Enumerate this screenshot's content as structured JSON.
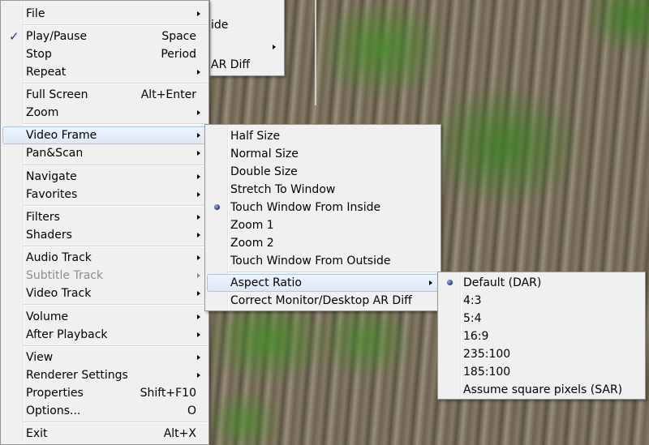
{
  "background_menu": {
    "items": [
      {
        "label": "ide"
      },
      {
        "label": "AR Diff"
      }
    ]
  },
  "main_menu": {
    "items": [
      {
        "label": "File",
        "shortcut": "",
        "submenu": true
      },
      {
        "label": "Play/Pause",
        "shortcut": "Space",
        "checked": true
      },
      {
        "label": "Stop",
        "shortcut": "Period"
      },
      {
        "label": "Repeat",
        "shortcut": "",
        "submenu": true
      },
      {
        "label": "Full Screen",
        "shortcut": "Alt+Enter"
      },
      {
        "label": "Zoom",
        "shortcut": "",
        "submenu": true
      },
      {
        "label": "Video Frame",
        "shortcut": "",
        "submenu": true,
        "highlighted": true
      },
      {
        "label": "Pan&Scan",
        "shortcut": "",
        "submenu": true
      },
      {
        "label": "Navigate",
        "shortcut": "",
        "submenu": true
      },
      {
        "label": "Favorites",
        "shortcut": "",
        "submenu": true
      },
      {
        "label": "Filters",
        "shortcut": "",
        "submenu": true
      },
      {
        "label": "Shaders",
        "shortcut": "",
        "submenu": true
      },
      {
        "label": "Audio Track",
        "shortcut": "",
        "submenu": true
      },
      {
        "label": "Subtitle Track",
        "shortcut": "",
        "submenu": true,
        "disabled": true
      },
      {
        "label": "Video Track",
        "shortcut": "",
        "submenu": true
      },
      {
        "label": "Volume",
        "shortcut": "",
        "submenu": true
      },
      {
        "label": "After Playback",
        "shortcut": "",
        "submenu": true
      },
      {
        "label": "View",
        "shortcut": "",
        "submenu": true
      },
      {
        "label": "Renderer Settings",
        "shortcut": "",
        "submenu": true
      },
      {
        "label": "Properties",
        "shortcut": "Shift+F10"
      },
      {
        "label": "Options...",
        "shortcut": "O"
      },
      {
        "label": "Exit",
        "shortcut": "Alt+X"
      }
    ]
  },
  "video_frame_menu": {
    "items": [
      {
        "label": "Half Size"
      },
      {
        "label": "Normal Size"
      },
      {
        "label": "Double Size"
      },
      {
        "label": "Stretch To Window"
      },
      {
        "label": "Touch Window From Inside",
        "selected": true
      },
      {
        "label": "Zoom 1"
      },
      {
        "label": "Zoom 2"
      },
      {
        "label": "Touch Window From Outside"
      },
      {
        "label": "Aspect Ratio",
        "submenu": true,
        "highlighted": true
      },
      {
        "label": "Correct Monitor/Desktop AR Diff"
      }
    ]
  },
  "aspect_ratio_menu": {
    "items": [
      {
        "label": "Default (DAR)",
        "selected": true
      },
      {
        "label": "4:3"
      },
      {
        "label": "5:4"
      },
      {
        "label": "16:9"
      },
      {
        "label": "235:100"
      },
      {
        "label": "185:100"
      },
      {
        "label": "Assume square pixels (SAR)"
      }
    ]
  }
}
